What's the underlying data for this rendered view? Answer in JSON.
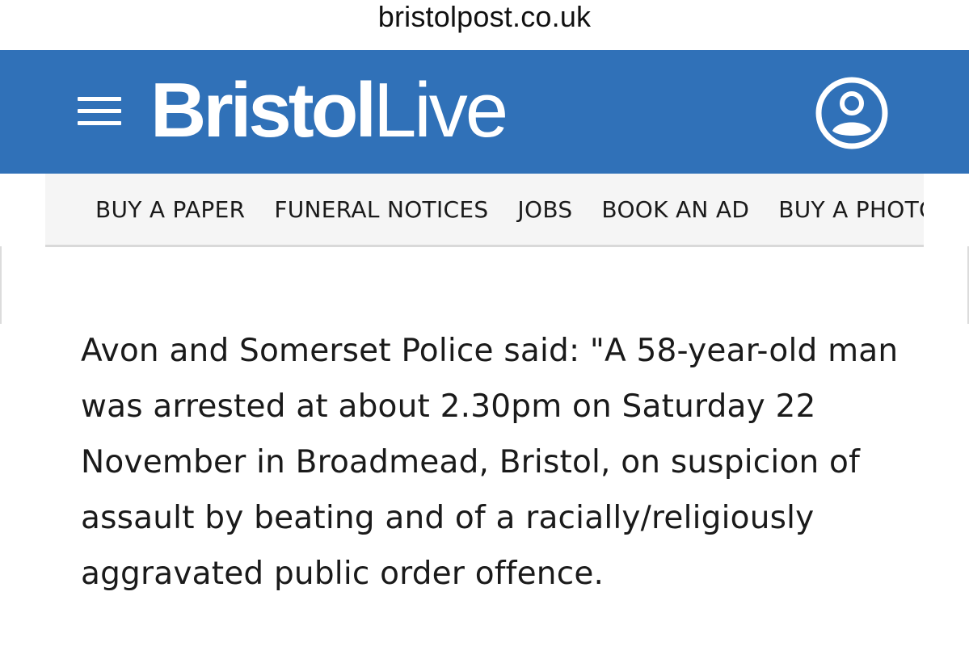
{
  "browser": {
    "url": "bristolpost.co.uk"
  },
  "masthead": {
    "logo_bold": "Bristol",
    "logo_light": "Live",
    "menu_icon": "hamburger-menu-icon",
    "account_icon": "user-account-icon",
    "brand_color": "#3071b8"
  },
  "nav": {
    "items": [
      {
        "label": "BUY A PAPER"
      },
      {
        "label": "FUNERAL NOTICES"
      },
      {
        "label": "JOBS"
      },
      {
        "label": "BOOK AN AD"
      },
      {
        "label": "BUY A PHOTO"
      }
    ]
  },
  "article": {
    "paragraph": "Avon and Somerset Police said: \"A 58-year-old man was arrested at about 2.30pm on Saturday 22 November in Broadmead, Bristol, on suspicion of assault by beating and of a racially/religiously aggravated public order offence."
  }
}
